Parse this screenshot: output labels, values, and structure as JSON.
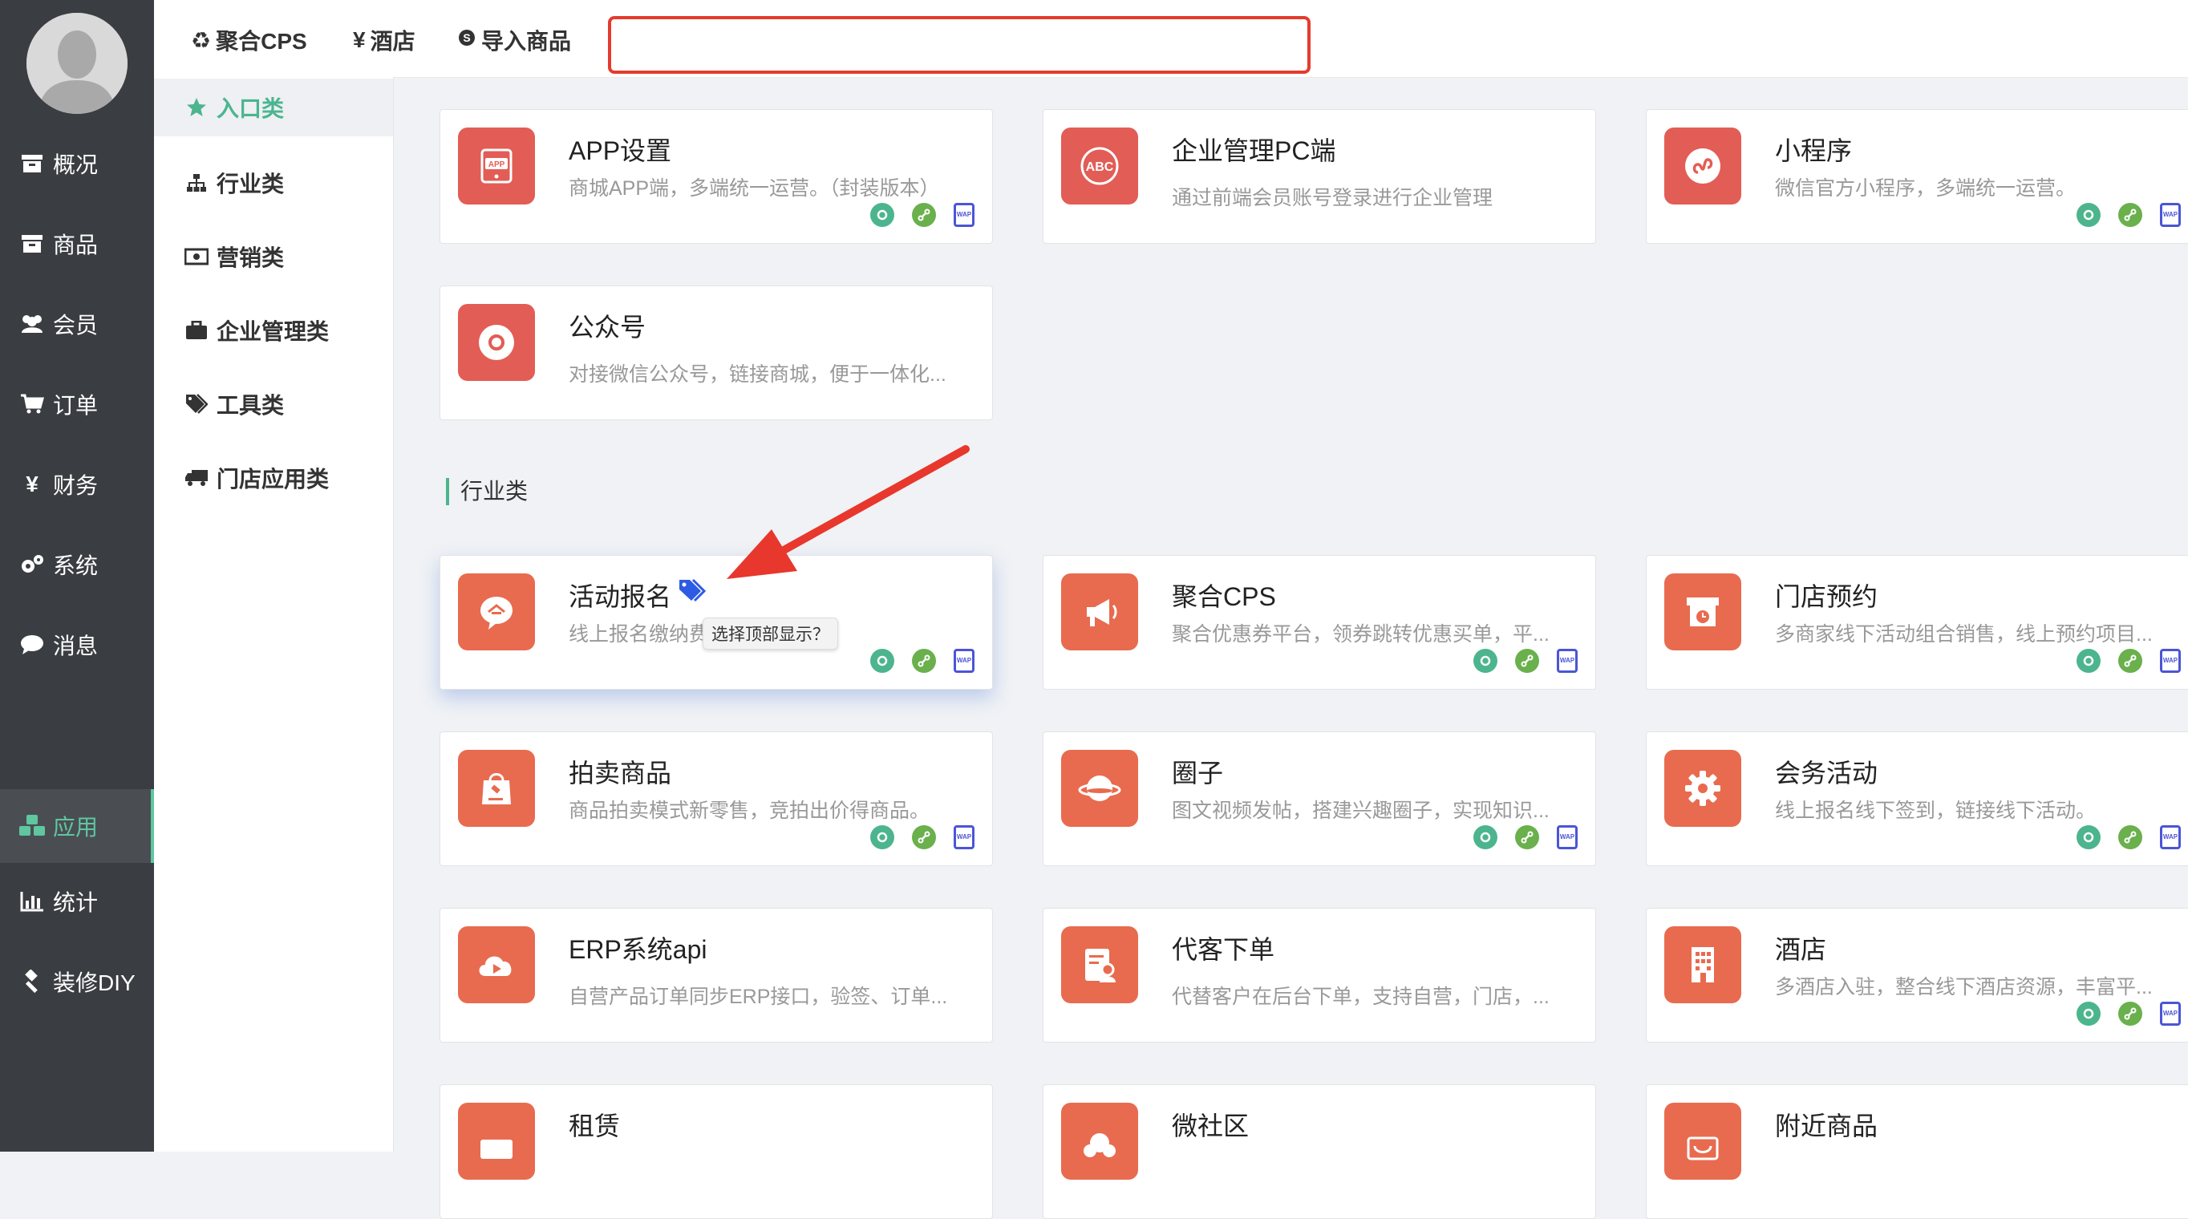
{
  "sidebar": {
    "items": [
      {
        "label": "概况"
      },
      {
        "label": "商品"
      },
      {
        "label": "会员"
      },
      {
        "label": "订单"
      },
      {
        "label": "财务"
      },
      {
        "label": "系统"
      },
      {
        "label": "消息"
      },
      {
        "label": "应用"
      },
      {
        "label": "统计"
      },
      {
        "label": "装修DIY"
      }
    ],
    "active_index": 7
  },
  "topbar": {
    "tabs": [
      {
        "label": "聚合CPS"
      },
      {
        "label": "酒店"
      },
      {
        "label": "导入商品"
      }
    ],
    "currency_symbol": "¥",
    "search_value": ""
  },
  "subnav": {
    "items": [
      {
        "label": "入口类"
      },
      {
        "label": "行业类"
      },
      {
        "label": "营销类"
      },
      {
        "label": "企业管理类"
      },
      {
        "label": "工具类"
      },
      {
        "label": "门店应用类"
      }
    ],
    "active_index": 0
  },
  "entry_cards": [
    {
      "title": "APP设置",
      "desc": "商城APP端，多端统一运营。（封装版本）",
      "icon": "app-icon"
    },
    {
      "title": "企业管理PC端",
      "desc": "通过前端会员账号登录进行企业管理",
      "icon": "abc-icon"
    },
    {
      "title": "小程序",
      "desc": "微信官方小程序，多端统一运营。",
      "icon": "miniprogram-icon"
    },
    {
      "title": "公众号",
      "desc": "对接微信公众号，链接商城，便于一体化...",
      "icon": "official-account-icon"
    }
  ],
  "section": {
    "industry_title": "行业类"
  },
  "industry_cards": [
    {
      "title": "活动报名",
      "desc": "线上报名缴纳费用，营销设置。",
      "icon": "event-signup-icon"
    },
    {
      "title": "聚合CPS",
      "desc": "聚合优惠券平台，领券跳转优惠买单，平...",
      "icon": "megaphone-icon"
    },
    {
      "title": "门店预约",
      "desc": "多商家线下活动组合销售，线上预约项目...",
      "icon": "store-clock-icon"
    },
    {
      "title": "拍卖商品",
      "desc": "商品拍卖模式新零售，竞拍出价得商品。",
      "icon": "auction-icon"
    },
    {
      "title": "圈子",
      "desc": "图文视频发帖，搭建兴趣圈子，实现知识...",
      "icon": "planet-icon"
    },
    {
      "title": "会务活动",
      "desc": "线上报名线下签到，链接线下活动。",
      "icon": "gear-icon"
    },
    {
      "title": "ERP系统api",
      "desc": "自营产品订单同步ERP接口，验签、订单...",
      "icon": "cloud-play-icon"
    },
    {
      "title": "代客下单",
      "desc": "代替客户在后台下单，支持自营，门店，...",
      "icon": "order-person-icon"
    },
    {
      "title": "酒店",
      "desc": "多酒店入驻，整合线下酒店资源，丰富平...",
      "icon": "building-icon"
    },
    {
      "title": "租赁",
      "desc": "",
      "icon": "rent-icon"
    },
    {
      "title": "微社区",
      "desc": "",
      "icon": "community-icon"
    },
    {
      "title": "附近商品",
      "desc": "",
      "icon": "nearby-icon"
    }
  ],
  "tooltip": {
    "text": "选择顶部显示？"
  },
  "colors": {
    "sidebar_bg": "#3a3d41",
    "accent_green": "#4cb58e",
    "entry_icon_red": "#e25d55",
    "industry_icon_orange": "#e86b4f",
    "search_border_red": "#e53b2c",
    "annotation_arrow_red": "#e8372c"
  }
}
